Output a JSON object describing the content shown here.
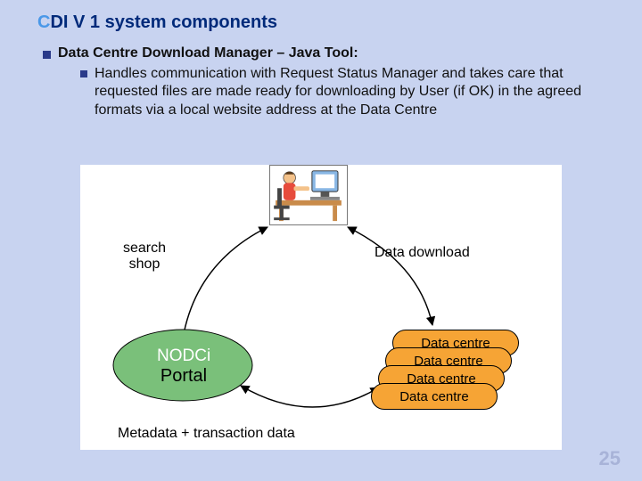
{
  "title": {
    "c": "C",
    "rest": "DI V 1 system components"
  },
  "bullet1": "Data Centre Download Manager – Java Tool:",
  "bullet2": "Handles communication with Request Status Manager and takes care that requested files are made ready for downloading by User (if OK) in the agreed formats via a local website address at the Data Centre",
  "labels": {
    "search_shop_1": "search",
    "search_shop_2": "shop",
    "data_download": "Data download",
    "nodci": "NODCi",
    "portal": "Portal",
    "meta": "Metadata + transaction data",
    "dc": "Data centre"
  },
  "page_number": "25"
}
